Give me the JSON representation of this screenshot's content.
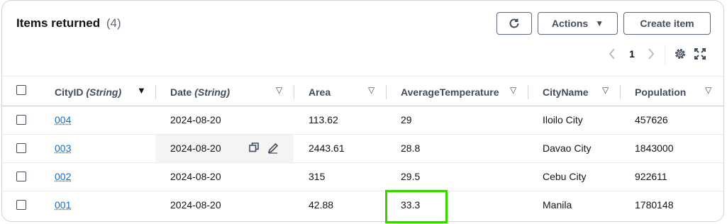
{
  "header": {
    "title": "Items returned",
    "count": "(4)",
    "refresh_icon": "refresh-icon",
    "actions_label": "Actions",
    "create_label": "Create item"
  },
  "pagination": {
    "current_page": "1",
    "prev_icon": "chevron-left-icon",
    "next_icon": "chevron-right-icon",
    "settings_icon": "gear-icon",
    "fullscreen_icon": "fullscreen-icon"
  },
  "columns": [
    {
      "label": "CityID",
      "type": "(String)",
      "sort": "▼"
    },
    {
      "label": "Date",
      "type": "(String)",
      "sort": "▽"
    },
    {
      "label": "Area",
      "type": "",
      "sort": "▽"
    },
    {
      "label": "AverageTemperature",
      "type": "",
      "sort": "▽"
    },
    {
      "label": "CityName",
      "type": "",
      "sort": "▽"
    },
    {
      "label": "Population",
      "type": "",
      "sort": "▽"
    }
  ],
  "rows": [
    {
      "cityid": "004",
      "date": "2024-08-20",
      "area": "113.62",
      "avgtemp": "29",
      "cityname": "Iloilo City",
      "population": "457626"
    },
    {
      "cityid": "003",
      "date": "2024-08-20",
      "area": "2443.61",
      "avgtemp": "28.8",
      "cityname": "Davao City",
      "population": "1843000"
    },
    {
      "cityid": "002",
      "date": "2024-08-20",
      "area": "315",
      "avgtemp": "29.5",
      "cityname": "Cebu City",
      "population": "922611"
    },
    {
      "cityid": "001",
      "date": "2024-08-20",
      "area": "42.88",
      "avgtemp": "33.3",
      "cityname": "Manila",
      "population": "1780148"
    }
  ],
  "colors": {
    "link": "#0972d3",
    "highlight": "#3ad200",
    "border": "#d1d5db"
  }
}
